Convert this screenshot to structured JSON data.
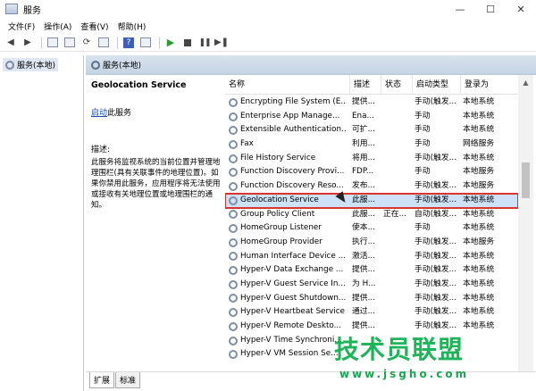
{
  "window": {
    "title": "服务",
    "minimize": "—",
    "maximize": "☐",
    "close": "✕"
  },
  "menu": [
    "文件(F)",
    "操作(A)",
    "查看(V)",
    "帮助(H)"
  ],
  "tree": {
    "root": "服务(本地)"
  },
  "panel": {
    "header": "服务(本地)"
  },
  "details": {
    "service_name": "Geolocation Service",
    "start_link": "启动",
    "start_suffix": "此服务",
    "description_label": "描述:",
    "description": "此服务将监视系统的当前位置并管理地理围栏(具有关联事件的地理位置)。如果你禁用此服务，应用程序将无法使用或接收有关地理位置或地理围栏的通知。"
  },
  "table": {
    "columns": [
      "名称",
      "描述",
      "状态",
      "启动类型",
      "登录为"
    ],
    "rows": [
      {
        "name": "Encrypting File System (E...",
        "desc": "提供...",
        "status": "",
        "start": "手动(触发...",
        "logon": "本地系统"
      },
      {
        "name": "Enterprise App Manage...",
        "desc": "Ena...",
        "status": "",
        "start": "手动",
        "logon": "本地系统"
      },
      {
        "name": "Extensible Authentication...",
        "desc": "可扩...",
        "status": "",
        "start": "手动",
        "logon": "本地系统"
      },
      {
        "name": "Fax",
        "desc": "利用...",
        "status": "",
        "start": "手动",
        "logon": "网络服务"
      },
      {
        "name": "File History Service",
        "desc": "将用...",
        "status": "",
        "start": "手动(触发...",
        "logon": "本地系统"
      },
      {
        "name": "Function Discovery Provi...",
        "desc": "FDP...",
        "status": "",
        "start": "手动",
        "logon": "本地服务"
      },
      {
        "name": "Function Discovery Reso...",
        "desc": "发布...",
        "status": "",
        "start": "手动(触发...",
        "logon": "本地服务"
      },
      {
        "name": "Geolocation Service",
        "desc": "此服...",
        "status": "",
        "start": "手动(触发...",
        "logon": "本地系统",
        "selected": true
      },
      {
        "name": "Group Policy Client",
        "desc": "此服...",
        "status": "正在...",
        "start": "自动(触发...",
        "logon": "本地系统"
      },
      {
        "name": "HomeGroup Listener",
        "desc": "使本...",
        "status": "",
        "start": "手动",
        "logon": "本地系统"
      },
      {
        "name": "HomeGroup Provider",
        "desc": "执行...",
        "status": "",
        "start": "手动(触发...",
        "logon": "本地服务"
      },
      {
        "name": "Human Interface Device ...",
        "desc": "激活...",
        "status": "",
        "start": "手动(触发...",
        "logon": "本地系统"
      },
      {
        "name": "Hyper-V Data Exchange ...",
        "desc": "提供...",
        "status": "",
        "start": "手动(触发...",
        "logon": "本地系统"
      },
      {
        "name": "Hyper-V Guest Service In...",
        "desc": "为 H...",
        "status": "",
        "start": "手动(触发...",
        "logon": "本地系统"
      },
      {
        "name": "Hyper-V Guest Shutdown...",
        "desc": "提供...",
        "status": "",
        "start": "手动(触发...",
        "logon": "本地系统"
      },
      {
        "name": "Hyper-V Heartbeat Service",
        "desc": "通过...",
        "status": "",
        "start": "手动(触发...",
        "logon": "本地系统"
      },
      {
        "name": "Hyper-V Remote Deskto...",
        "desc": "提供...",
        "status": "",
        "start": "手动(触发...",
        "logon": "本地系统"
      },
      {
        "name": "Hyper-V Time Synchroni...",
        "desc": "",
        "status": "",
        "start": "",
        "logon": ""
      },
      {
        "name": "Hyper-V VM Session Se...",
        "desc": "",
        "status": "",
        "start": "",
        "logon": ""
      }
    ]
  },
  "tabs": [
    "扩展",
    "标准"
  ],
  "watermark": {
    "text": "技术员联盟",
    "url": "www.jsgho.com"
  }
}
